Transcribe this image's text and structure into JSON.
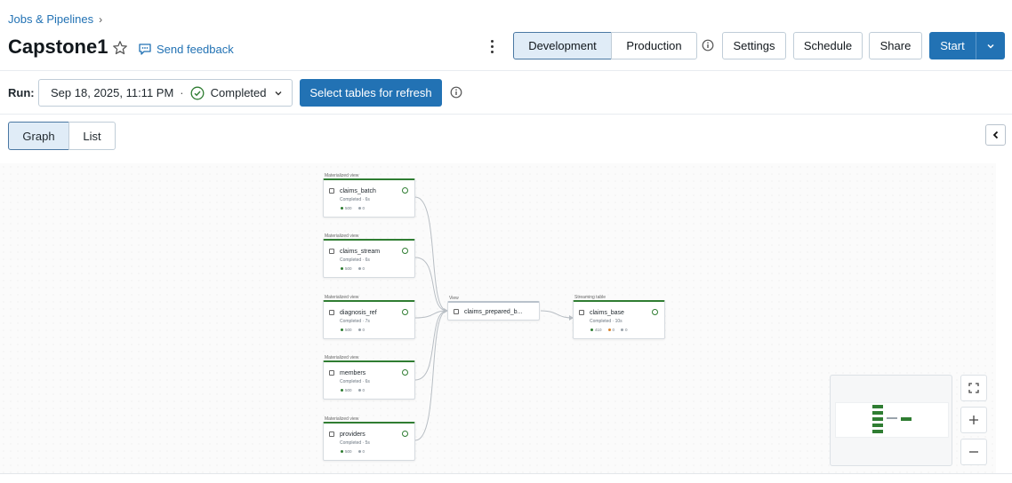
{
  "breadcrumb": {
    "label": "Jobs & Pipelines",
    "separator": "›"
  },
  "header": {
    "title": "Capstone1",
    "feedback_label": "Send feedback",
    "mode_development": "Development",
    "mode_production": "Production",
    "settings_label": "Settings",
    "schedule_label": "Schedule",
    "share_label": "Share",
    "start_label": "Start"
  },
  "run": {
    "label": "Run:",
    "date": "Sep 18, 2025, 11:11 PM",
    "separator": "·",
    "status": "Completed",
    "refresh_label": "Select tables for refresh"
  },
  "view_tabs": {
    "graph": "Graph",
    "list": "List"
  },
  "nodes": [
    {
      "type": "Materialized view",
      "name": "claims_batch",
      "status": "Completed · 6s",
      "m1": "500",
      "m2": "0"
    },
    {
      "type": "Materialized view",
      "name": "claims_stream",
      "status": "Completed · 6s",
      "m1": "500",
      "m2": "0"
    },
    {
      "type": "Materialized view",
      "name": "diagnosis_ref",
      "status": "Completed · 7s",
      "m1": "500",
      "m2": "0"
    },
    {
      "type": "Materialized view",
      "name": "members",
      "status": "Completed · 6s",
      "m1": "500",
      "m2": "0"
    },
    {
      "type": "Materialized view",
      "name": "providers",
      "status": "Completed · 5s",
      "m1": "500",
      "m2": "0"
    }
  ],
  "view_node": {
    "type": "View",
    "name": "claims_prepared_b..."
  },
  "streaming_node": {
    "type": "Streaming table",
    "name": "claims_base",
    "status": "Completed · 10s",
    "m1": "410",
    "m2": "0",
    "m3": "0"
  },
  "colors": {
    "accent": "#2272b4",
    "success": "#2f7d32",
    "warning": "#d9822b"
  }
}
